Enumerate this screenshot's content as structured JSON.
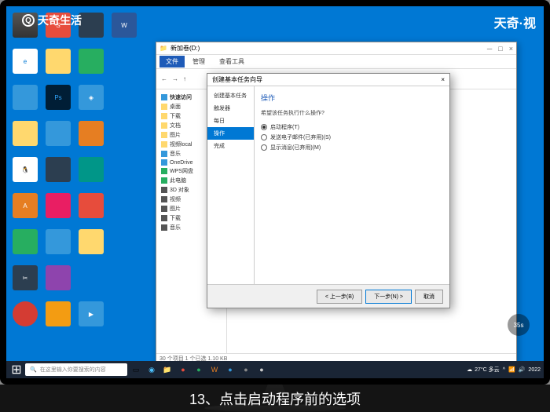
{
  "watermark": {
    "left": "天奇生活",
    "right": "天奇·视"
  },
  "caption": "13、点击启动程序前的选项",
  "timer": "35s",
  "taskbar": {
    "search_placeholder": "在这里输入你要搜索的内容",
    "weather": "27°C 多云",
    "time": "2022"
  },
  "explorer": {
    "title": "新加卷(D:)",
    "tabs": {
      "file": "文件",
      "manage": "管理",
      "tools": "查看工具"
    },
    "nav_header": "快速访问",
    "nav": [
      "桌面",
      "下载",
      "文档",
      "图片",
      "视频local",
      "音乐",
      "OneDrive",
      "WPS网盘",
      "此电脑",
      "3D 对象",
      "视频",
      "图片",
      "下载",
      "音乐"
    ],
    "status": "30 个项目  1 个已选  1.10 KB"
  },
  "dialog": {
    "title": "创建基本任务向导",
    "close": "×",
    "side": [
      "创建基本任务",
      "触发器",
      "每日",
      "操作",
      "完成"
    ],
    "side_selected": 3,
    "heading": "操作",
    "question": "希望该任务执行什么操作?",
    "options": [
      {
        "label": "启动程序(T)",
        "checked": true
      },
      {
        "label": "发送电子邮件(已弃用)(S)",
        "checked": false
      },
      {
        "label": "显示消息(已弃用)(M)",
        "checked": false
      }
    ],
    "buttons": {
      "back": "< 上一步(B)",
      "next": "下一步(N) >",
      "cancel": "取消"
    }
  }
}
